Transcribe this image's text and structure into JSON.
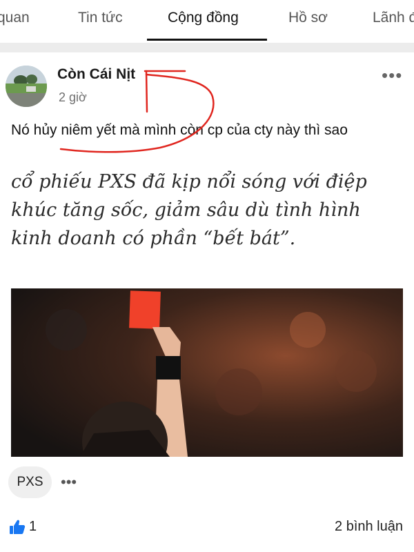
{
  "tabs": [
    {
      "label": "quan"
    },
    {
      "label": "Tin tức"
    },
    {
      "label": "Cộng đồng"
    },
    {
      "label": "Hồ sơ"
    },
    {
      "label": "Lãnh đ"
    }
  ],
  "active_tab": "Cộng đồng",
  "post": {
    "author": "Còn Cái Nịt",
    "time": "2 giờ",
    "more_icon": "more-horizontal-icon",
    "text": "Nó hủy niêm yết mà mình còn cp của cty này thì sao",
    "quote": "cổ phiếu PXS đã kịp nổi sóng với điệp khúc tăng sốc, giảm sâu dù tình hình kinh doanh có phần “bết bát”.",
    "tag": "PXS",
    "likes": "1",
    "comments": "2 bình luận"
  },
  "colors": {
    "annotation": "#e0261f",
    "like": "#1877f2",
    "separator": "#ececec"
  }
}
